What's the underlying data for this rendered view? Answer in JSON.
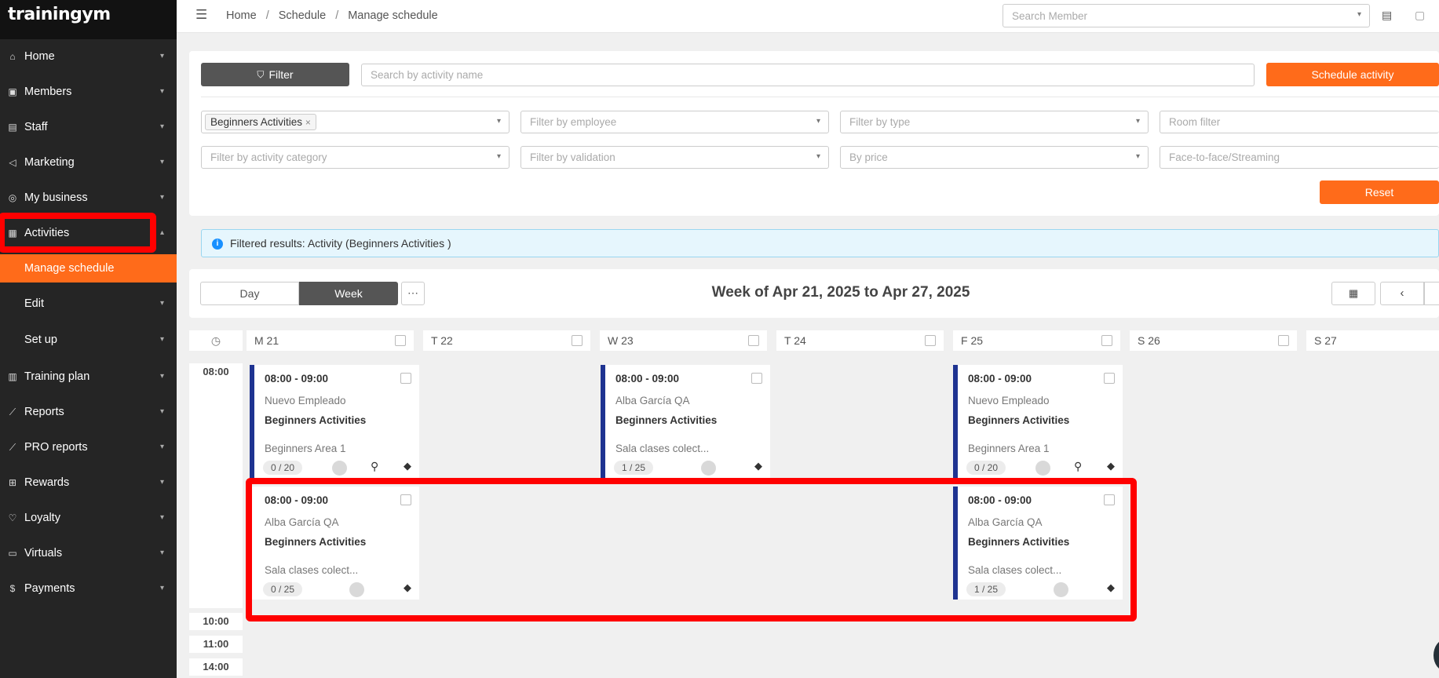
{
  "app": {
    "logo": "trainingym"
  },
  "sidebar": {
    "items": [
      {
        "label": "Home",
        "icon": "home-icon"
      },
      {
        "label": "Members",
        "icon": "id-card-icon"
      },
      {
        "label": "Staff",
        "icon": "badge-icon"
      },
      {
        "label": "Marketing",
        "icon": "megaphone-icon"
      },
      {
        "label": "My business",
        "icon": "location-pin-icon"
      },
      {
        "label": "Activities",
        "icon": "calendar-icon"
      },
      {
        "label": "Training plan",
        "icon": "clipboard-icon"
      },
      {
        "label": "Reports",
        "icon": "line-chart-icon"
      },
      {
        "label": "PRO reports",
        "icon": "line-chart-icon"
      },
      {
        "label": "Rewards",
        "icon": "gift-icon"
      },
      {
        "label": "Loyalty",
        "icon": "heart-icon"
      },
      {
        "label": "Virtuals",
        "icon": "video-icon"
      },
      {
        "label": "Payments",
        "icon": "dollar-icon"
      }
    ],
    "activities_sub": [
      {
        "label": "Manage schedule"
      },
      {
        "label": "Edit"
      },
      {
        "label": "Set up"
      }
    ]
  },
  "header": {
    "breadcrumb": [
      "Home",
      "Schedule",
      "Manage schedule"
    ],
    "search_member_placeholder": "Search Member"
  },
  "toolbar": {
    "filter_label": "Filter",
    "search_placeholder": "Search by activity name",
    "schedule_label": "Schedule activity"
  },
  "filters": {
    "activity_tag": "Beginners Activities",
    "employee": "Filter by employee",
    "type": "Filter by type",
    "room": "Room filter",
    "category": "Filter by activity category",
    "validation": "Filter by validation",
    "price": "By price",
    "mode": "Face-to-face/Streaming",
    "reset_label": "Reset"
  },
  "info": {
    "text": "Filtered results: Activity (Beginners Activities )"
  },
  "view": {
    "day_label": "Day",
    "week_label": "Week",
    "week_title": "Week of Apr 21, 2025 to Apr 27, 2025"
  },
  "days": [
    "M 21",
    "T 22",
    "W 23",
    "T 24",
    "F 25",
    "S 26",
    "S 27"
  ],
  "times": [
    "08:00",
    "10:00",
    "11:00",
    "14:00"
  ],
  "events": [
    {
      "time": "08:00 - 09:00",
      "employee": "Nuevo Empleado",
      "activity": "Beginners Activities",
      "room": "Beginners Area 1",
      "capacity": "0 / 20"
    },
    {
      "time": "08:00 - 09:00",
      "employee": "Alba García QA",
      "activity": "Beginners Activities",
      "room": "Sala clases colect...",
      "capacity": "1 / 25"
    },
    {
      "time": "08:00 - 09:00",
      "employee": "Nuevo Empleado",
      "activity": "Beginners Activities",
      "room": "Beginners Area 1",
      "capacity": "0 / 20"
    },
    {
      "time": "08:00 - 09:00",
      "employee": "Alba García QA",
      "activity": "Beginners Activities",
      "room": "Sala clases colect...",
      "capacity": "0 / 25"
    },
    {
      "time": "08:00 - 09:00",
      "employee": "Alba García QA",
      "activity": "Beginners Activities",
      "room": "Sala clases colect...",
      "capacity": "1 / 25"
    }
  ],
  "colors": {
    "accent": "#ff6b1a",
    "event_bar": "#1e3391",
    "highlight": "#ff0000"
  }
}
